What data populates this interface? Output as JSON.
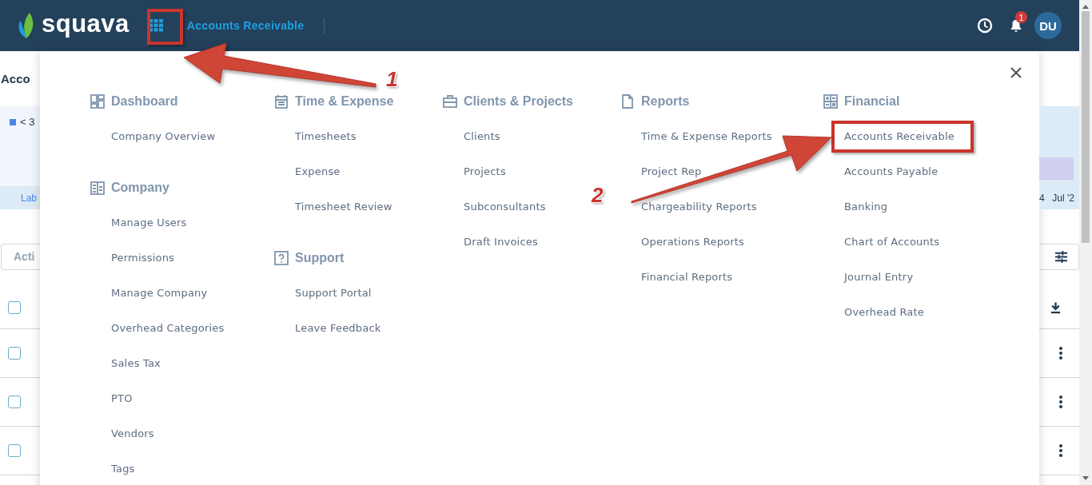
{
  "header": {
    "logo": "squava",
    "app_title": "Accounts Receivable",
    "notification_count": "1",
    "avatar": "DU"
  },
  "background": {
    "title": "Acco",
    "legend": "< 3",
    "chart_label": "Lab",
    "axis_labels": [
      "4",
      "Jul '2"
    ],
    "action_field": "Acti",
    "rows": [
      {
        "checked": false
      },
      {
        "checked": false
      },
      {
        "checked": false
      },
      {
        "checked": false
      }
    ]
  },
  "menu": {
    "columns": [
      {
        "sections": [
          {
            "kind": "dashboard",
            "title": "Dashboard",
            "items": [
              "Company Overview"
            ]
          },
          {
            "kind": "company",
            "title": "Company",
            "items": [
              "Manage Users",
              "Permissions",
              "Manage Company",
              "Overhead Categories",
              "Sales Tax",
              "PTO",
              "Vendors",
              "Tags"
            ]
          }
        ]
      },
      {
        "sections": [
          {
            "kind": "time",
            "title": "Time & Expense",
            "items": [
              "Timesheets",
              "Expense",
              "Timesheet Review"
            ]
          },
          {
            "kind": "support",
            "title": "Support",
            "items": [
              "Support Portal",
              "Leave Feedback"
            ]
          }
        ]
      },
      {
        "sections": [
          {
            "kind": "clients",
            "title": "Clients & Projects",
            "items": [
              "Clients",
              "Projects",
              "Subconsultants",
              "Draft Invoices"
            ]
          }
        ]
      },
      {
        "sections": [
          {
            "kind": "reports",
            "title": "Reports",
            "items": [
              "Time & Expense Reports",
              "Project Rep",
              "Chargeability Reports",
              "Operations Reports",
              "Financial Reports"
            ]
          }
        ]
      },
      {
        "sections": [
          {
            "kind": "financial",
            "title": "Financial",
            "items": [
              "Accounts Receivable",
              "Accounts Payable",
              "Banking",
              "Chart of Accounts",
              "Journal Entry",
              "Overhead Rate"
            ]
          }
        ]
      }
    ]
  },
  "annotations": [
    {
      "kind": "arrow",
      "label": "1"
    },
    {
      "kind": "arrow",
      "label": "2"
    }
  ]
}
